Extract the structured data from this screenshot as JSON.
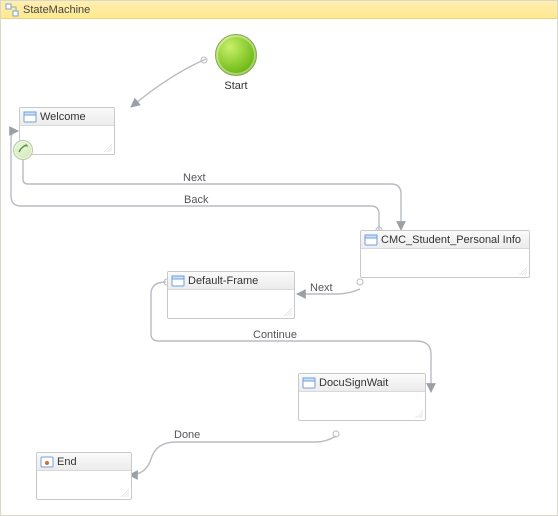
{
  "header": {
    "title": "StateMachine"
  },
  "start": {
    "label": "Start"
  },
  "states": {
    "welcome": {
      "label": "Welcome"
    },
    "cmc": {
      "label": "CMC_Student_Personal Info"
    },
    "default": {
      "label": "Default-Frame"
    },
    "docusign": {
      "label": "DocuSignWait"
    },
    "end": {
      "label": "End"
    }
  },
  "edges": {
    "next1": {
      "label": "Next"
    },
    "back": {
      "label": "Back"
    },
    "next2": {
      "label": "Next"
    },
    "continue": {
      "label": "Continue"
    },
    "done": {
      "label": "Done"
    }
  },
  "chart_data": {
    "type": "state_machine",
    "title": "StateMachine",
    "nodes": [
      {
        "id": "start",
        "kind": "initial",
        "label": "Start"
      },
      {
        "id": "welcome",
        "kind": "state",
        "label": "Welcome"
      },
      {
        "id": "cmc",
        "kind": "state",
        "label": "CMC_Student_Personal Info"
      },
      {
        "id": "defaultframe",
        "kind": "state",
        "label": "Default-Frame"
      },
      {
        "id": "docusign",
        "kind": "state",
        "label": "DocuSignWait"
      },
      {
        "id": "end",
        "kind": "final",
        "label": "End"
      }
    ],
    "edges": [
      {
        "from": "start",
        "to": "welcome",
        "label": ""
      },
      {
        "from": "welcome",
        "to": "cmc",
        "label": "Next"
      },
      {
        "from": "cmc",
        "to": "welcome",
        "label": "Back"
      },
      {
        "from": "cmc",
        "to": "defaultframe",
        "label": "Next"
      },
      {
        "from": "defaultframe",
        "to": "docusign",
        "label": "Continue"
      },
      {
        "from": "docusign",
        "to": "end",
        "label": "Done"
      }
    ]
  }
}
